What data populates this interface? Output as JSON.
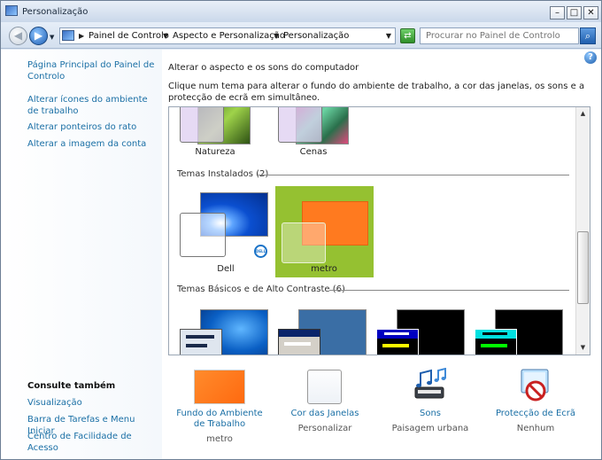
{
  "window": {
    "title": "Personalização"
  },
  "address": {
    "crumbs": [
      "Painel de Controlo",
      "Aspecto e Personalização",
      "Personalização"
    ],
    "search_placeholder": "Procurar no Painel de Controlo"
  },
  "sidebar": {
    "links": [
      "Página Principal do Painel de Controlo",
      "Alterar ícones do ambiente de trabalho",
      "Alterar ponteiros do rato",
      "Alterar a imagem da conta"
    ],
    "see_also_title": "Consulte também",
    "see_also_links": [
      "Visualização",
      "Barra de Tarefas e Menu Iniciar",
      "Centro de Facilidade de Acesso"
    ]
  },
  "main": {
    "title": "Alterar o aspecto e os sons do computador",
    "description": "Clique num tema para alterar o fundo do ambiente de trabalho, a cor das janelas, os sons e a protecção de ecrã em simultâneo."
  },
  "themes": {
    "top_row": [
      {
        "label": "Natureza"
      },
      {
        "label": "Cenas"
      }
    ],
    "installed_header": "Temas Instalados (2)",
    "installed": [
      {
        "label": "Dell"
      },
      {
        "label": "metro"
      }
    ],
    "basic_header": "Temas Básicos e de Alto Contraste (6)",
    "dell_badge": "DELL"
  },
  "bottom": {
    "items": [
      {
        "label": "Fundo do Ambiente de Trabalho",
        "value": "metro"
      },
      {
        "label": "Cor das Janelas",
        "value": "Personalizar"
      },
      {
        "label": "Sons",
        "value": "Paisagem urbana"
      },
      {
        "label": "Protecção de Ecrã",
        "value": "Nenhum"
      }
    ]
  },
  "colors": {
    "link": "#1a6fa5",
    "selected": "#95c131",
    "metro_orange": "#ff7a1f"
  }
}
